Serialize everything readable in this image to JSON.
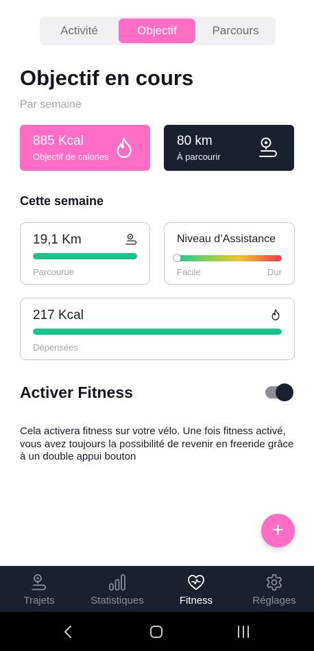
{
  "tabs": [
    {
      "label": "Activité",
      "active": false
    },
    {
      "label": "Objectif",
      "active": true
    },
    {
      "label": "Parcours",
      "active": false
    }
  ],
  "header": {
    "title": "Objectif en cours",
    "subtitle": "Par semaine"
  },
  "goals": {
    "calories": {
      "value": "885 Kcal",
      "label": "Objectif de calories",
      "icon": "flame-icon",
      "color": "#ff6ec4"
    },
    "distance": {
      "value": "80 km",
      "label": "À parcourir",
      "icon": "route-pin-icon",
      "color": "#19202e"
    }
  },
  "week": {
    "title": "Cette semaine",
    "distance": {
      "value": "19,1 Km",
      "label": "Parcourue",
      "progress": 1.0,
      "icon": "route-pin-icon"
    },
    "assistance": {
      "title": "Niveau d’Assistance",
      "min_label": "Facile",
      "max_label": "Dur",
      "level": 0.0
    },
    "calories": {
      "value": "217 Kcal",
      "label": "Dépensées",
      "progress": 1.0,
      "icon": "flame-icon"
    }
  },
  "fitness": {
    "title": "Activer Fitness",
    "enabled": true,
    "description": "Cela activera fitness sur votre vélo. Une fois fitness activé, vous avez toujours la possibilité de revenir en freeride grâce à un double appui bouton"
  },
  "fab": {
    "label": "+"
  },
  "bottom_nav": [
    {
      "label": "Trajets",
      "icon": "route-pin-icon",
      "active": false
    },
    {
      "label": "Statistiques",
      "icon": "bar-chart-icon",
      "active": false
    },
    {
      "label": "Fitness",
      "icon": "heart-pulse-icon",
      "active": true
    },
    {
      "label": "Réglages",
      "icon": "gear-icon",
      "active": false
    }
  ],
  "colors": {
    "accent": "#ff6ec4",
    "dark": "#19202e",
    "progress": "#16c48b"
  }
}
